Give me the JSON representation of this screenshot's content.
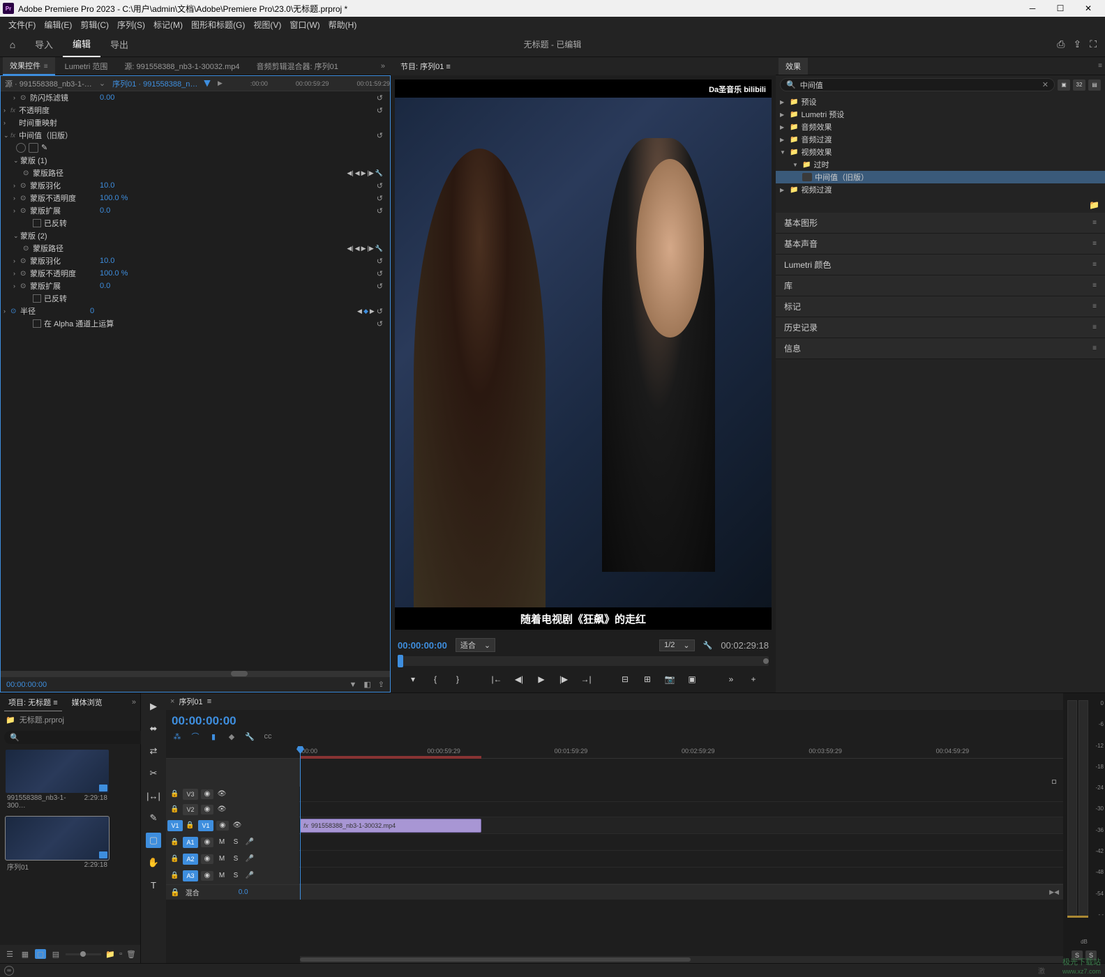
{
  "titlebar": {
    "app_icon": "Pr",
    "title": "Adobe Premiere Pro 2023 - C:\\用户\\admin\\文档\\Adobe\\Premiere Pro\\23.0\\无标题.prproj *"
  },
  "menubar": [
    "文件(F)",
    "编辑(E)",
    "剪辑(C)",
    "序列(S)",
    "标记(M)",
    "图形和标题(G)",
    "视图(V)",
    "窗口(W)",
    "帮助(H)"
  ],
  "workspace": {
    "tabs": [
      "导入",
      "编辑",
      "导出"
    ],
    "active": 1,
    "center_title": "无标题 - 已编辑"
  },
  "effect_controls": {
    "tabs": [
      "效果控件",
      "Lumetri 范围",
      "源: 991558388_nb3-1-30032.mp4",
      "音频剪辑混合器: 序列01"
    ],
    "active": 0,
    "source_label": "源 · 991558388_nb3-1-30032…",
    "sequence_label": "序列01 · 991558388_nb3-…",
    "timeline_marks": [
      ":00:00",
      "00:00:59:29",
      "00:01:59:29"
    ],
    "rows": [
      {
        "type": "effect",
        "name": "防闪烁滤镜",
        "value": "0.00",
        "stopwatch": true,
        "reset": true
      },
      {
        "type": "group",
        "name": "不透明度",
        "fx": true,
        "reset": true
      },
      {
        "type": "group",
        "name": "时间重映射"
      },
      {
        "type": "effect-header",
        "name": "中间值（旧版）",
        "fx": true,
        "shapes": true,
        "reset": true
      },
      {
        "type": "mask-header",
        "name": "蒙版 (1)"
      },
      {
        "type": "mask-path",
        "name": "蒙版路径",
        "transport": true
      },
      {
        "type": "prop",
        "name": "蒙版羽化",
        "value": "10.0",
        "stopwatch": true,
        "reset": true
      },
      {
        "type": "prop",
        "name": "蒙版不透明度",
        "value": "100.0 %",
        "stopwatch": true,
        "reset": true
      },
      {
        "type": "prop",
        "name": "蒙版扩展",
        "value": "0.0",
        "stopwatch": true,
        "reset": true
      },
      {
        "type": "checkbox",
        "name": "已反转"
      },
      {
        "type": "mask-header",
        "name": "蒙版 (2)"
      },
      {
        "type": "mask-path",
        "name": "蒙版路径",
        "transport": true
      },
      {
        "type": "prop",
        "name": "蒙版羽化",
        "value": "10.0",
        "stopwatch": true,
        "reset": true
      },
      {
        "type": "prop",
        "name": "蒙版不透明度",
        "value": "100.0 %",
        "stopwatch": true,
        "reset": true
      },
      {
        "type": "prop",
        "name": "蒙版扩展",
        "value": "0.0",
        "stopwatch": true,
        "reset": true
      },
      {
        "type": "checkbox",
        "name": "已反转"
      },
      {
        "type": "prop-kf",
        "name": "半径",
        "value": "0",
        "stopwatch": true,
        "reset": true
      },
      {
        "type": "checkbox-alpha",
        "name": "在 Alpha 通道上运算"
      }
    ],
    "footer_time": "00:00:00:00"
  },
  "program": {
    "tab": "节目: 序列01",
    "overlay_text": "Da圣音乐  bilibili",
    "subtitle": "随着电视剧《狂飙》的走红",
    "timecode": "00:00:00:00",
    "fit": "适合",
    "zoom": "1/2",
    "duration": "00:02:29:18"
  },
  "effects_panel": {
    "title": "效果",
    "search": "中间值",
    "tree": [
      {
        "name": "预设",
        "arrow": "▶",
        "indent": 0
      },
      {
        "name": "Lumetri 预设",
        "arrow": "▶",
        "indent": 0
      },
      {
        "name": "音频效果",
        "arrow": "▶",
        "indent": 0
      },
      {
        "name": "音频过渡",
        "arrow": "▶",
        "indent": 0
      },
      {
        "name": "视频效果",
        "arrow": "▼",
        "indent": 0
      },
      {
        "name": "过时",
        "arrow": "▼",
        "indent": 1
      },
      {
        "name": "中间值（旧版）",
        "arrow": "",
        "indent": 2,
        "selected": true,
        "fx": true
      },
      {
        "name": "视频过渡",
        "arrow": "▶",
        "indent": 0
      }
    ]
  },
  "side_panels": [
    "基本图形",
    "基本声音",
    "Lumetri 颜色",
    "库",
    "标记",
    "历史记录",
    "信息"
  ],
  "project": {
    "tabs": [
      "项目: 无标题",
      "媒体浏览"
    ],
    "breadcrumb": "无标题.prproj",
    "items": [
      {
        "name": "991558388_nb3-1-300…",
        "duration": "2:29:18"
      },
      {
        "name": "序列01",
        "duration": "2:29:18"
      }
    ]
  },
  "timeline": {
    "tab": "序列01",
    "timecode": "00:00:00:00",
    "ruler": [
      ":00:00",
      "00:00:59:29",
      "00:01:59:29",
      "00:02:59:29",
      "00:03:59:29",
      "00:04:59:29"
    ],
    "tracks_v": [
      "V3",
      "V2",
      "V1"
    ],
    "tracks_a": [
      "A1",
      "A2",
      "A3"
    ],
    "mix_label": "混合",
    "mix_value": "0.0",
    "clip_name": "991558388_nb3-1-30032.mp4",
    "audio_scale": [
      "0",
      "-6",
      "-12",
      "-18",
      "-24",
      "-30",
      "-36",
      "-42",
      "-48",
      "-54",
      "- -"
    ],
    "audio_db": "dB"
  }
}
